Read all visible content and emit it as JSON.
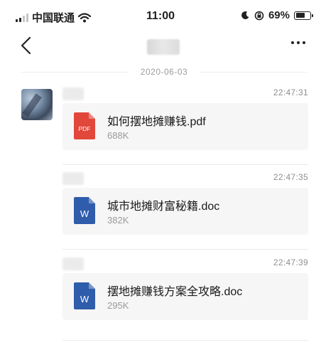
{
  "status_bar": {
    "carrier": "中国联通",
    "time": "11:00",
    "battery": "69%",
    "battery_level": 0.69
  },
  "nav": {
    "back_icon": "chevron-left-icon",
    "more_icon": "more-dots-icon"
  },
  "date_divider": "2020-06-03",
  "messages": [
    {
      "time": "22:47:31",
      "file_name": "如何摆地摊赚钱.pdf",
      "file_size": "688K",
      "file_type": "PDF",
      "icon_color": "#e2473b"
    },
    {
      "time": "22:47:35",
      "file_name": "城市地摊财富秘籍.doc",
      "file_size": "382K",
      "file_type": "W",
      "icon_color": "#2f5cab"
    },
    {
      "time": "22:47:39",
      "file_name": "摆地摊赚钱方案全攻略.doc",
      "file_size": "295K",
      "file_type": "W",
      "icon_color": "#2f5cab"
    }
  ]
}
